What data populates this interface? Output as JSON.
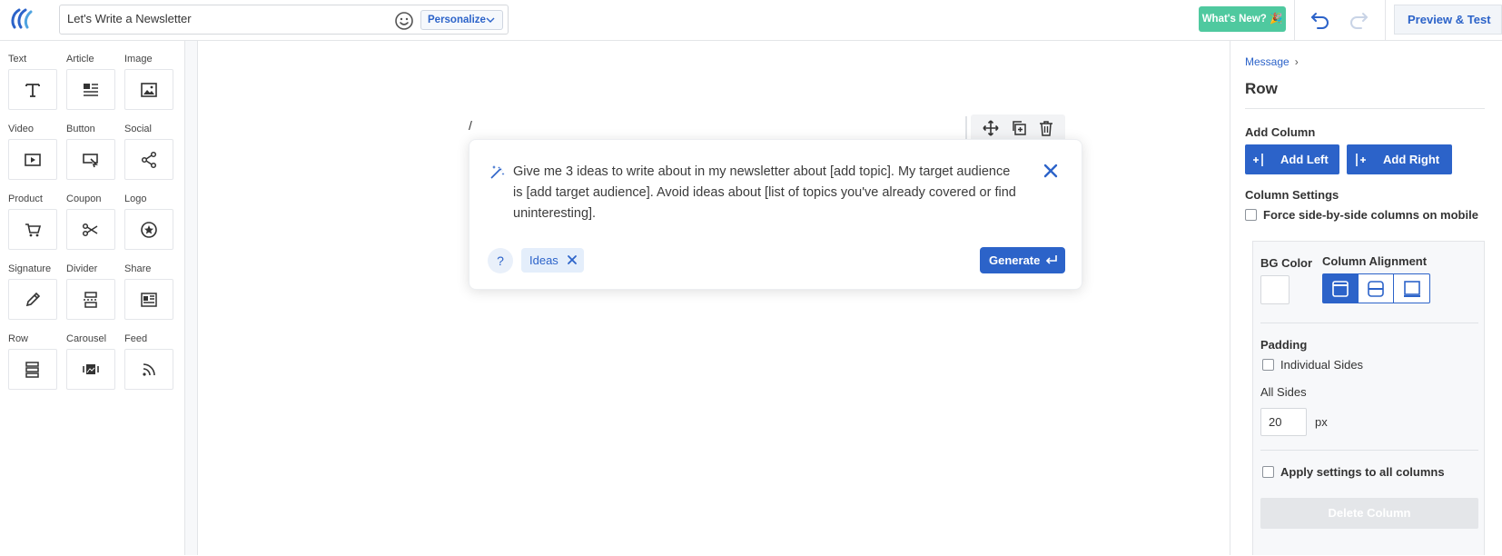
{
  "header": {
    "subject_value": "Let's Write a Newsletter",
    "personalize_label": "Personalize",
    "whats_new_label": "What's New? 🎉",
    "preview_label": "Preview & Test"
  },
  "blocks": [
    {
      "label": "Text",
      "icon": "text-icon"
    },
    {
      "label": "Article",
      "icon": "article-icon"
    },
    {
      "label": "Image",
      "icon": "image-icon"
    },
    {
      "label": "Video",
      "icon": "video-icon"
    },
    {
      "label": "Button",
      "icon": "button-icon"
    },
    {
      "label": "Social",
      "icon": "share-network-icon"
    },
    {
      "label": "Product",
      "icon": "cart-icon"
    },
    {
      "label": "Coupon",
      "icon": "scissors-icon"
    },
    {
      "label": "Logo",
      "icon": "badge-star-icon"
    },
    {
      "label": "Signature",
      "icon": "pen-icon"
    },
    {
      "label": "Divider",
      "icon": "divider-icon"
    },
    {
      "label": "Share",
      "icon": "newspaper-icon"
    },
    {
      "label": "Row",
      "icon": "rows-icon"
    },
    {
      "label": "Carousel",
      "icon": "carousel-icon"
    },
    {
      "label": "Feed",
      "icon": "rss-icon"
    }
  ],
  "canvas": {
    "slash_text": "/",
    "ai_prompt": "Give me 3 ideas to write about in my newsletter about [add topic]. My target audience is [add target audience]. Avoid ideas about [list of topics you've already covered or find uninteresting].",
    "help_label": "?",
    "tag_label": "Ideas",
    "generate_label": "Generate"
  },
  "panel": {
    "breadcrumb": "Message",
    "breadcrumb_arrow": "›",
    "title": "Row",
    "add_column_label": "Add Column",
    "add_left_label": "Add Left",
    "add_right_label": "Add Right",
    "column_settings_label": "Column Settings",
    "force_side_by_side_label": "Force side-by-side columns on mobile",
    "bg_color_label": "BG Color",
    "bg_color_value": "#ffffff",
    "column_alignment_label": "Column Alignment",
    "alignment_selected": "top",
    "padding_label": "Padding",
    "individual_sides_label": "Individual Sides",
    "all_sides_label": "All Sides",
    "all_sides_value": "20",
    "unit_label": "px",
    "apply_all_label": "Apply settings to all columns",
    "delete_column_label": "Delete Column"
  },
  "colors": {
    "accent": "#2c63c9",
    "whats_new_bg": "#4fc99f",
    "panel_bg": "#f7f8fa"
  }
}
